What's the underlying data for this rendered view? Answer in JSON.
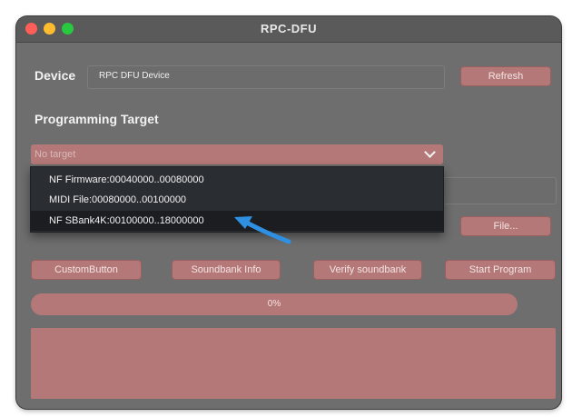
{
  "window": {
    "title": "RPC-DFU"
  },
  "device": {
    "label": "Device",
    "value": "RPC DFU Device",
    "refresh_label": "Refresh"
  },
  "programming_target": {
    "label": "Programming Target",
    "selected": "No target",
    "options": [
      "NF Firmware:00040000..00080000",
      "MIDI File:00080000..00100000",
      "NF SBank4K:00100000..18000000"
    ]
  },
  "file_button_label": "File...",
  "actions": {
    "custom": "CustomButton",
    "soundbank_info": "Soundbank Info",
    "verify_soundbank": "Verify soundbank",
    "start_program": "Start Program"
  },
  "progress": {
    "text": "0%",
    "value": 0
  },
  "colors": {
    "accent": "#b57878",
    "window_bg": "#6e6e6e",
    "dropdown_bg": "#2a2e32",
    "annotation_arrow": "#2f8fe0"
  }
}
